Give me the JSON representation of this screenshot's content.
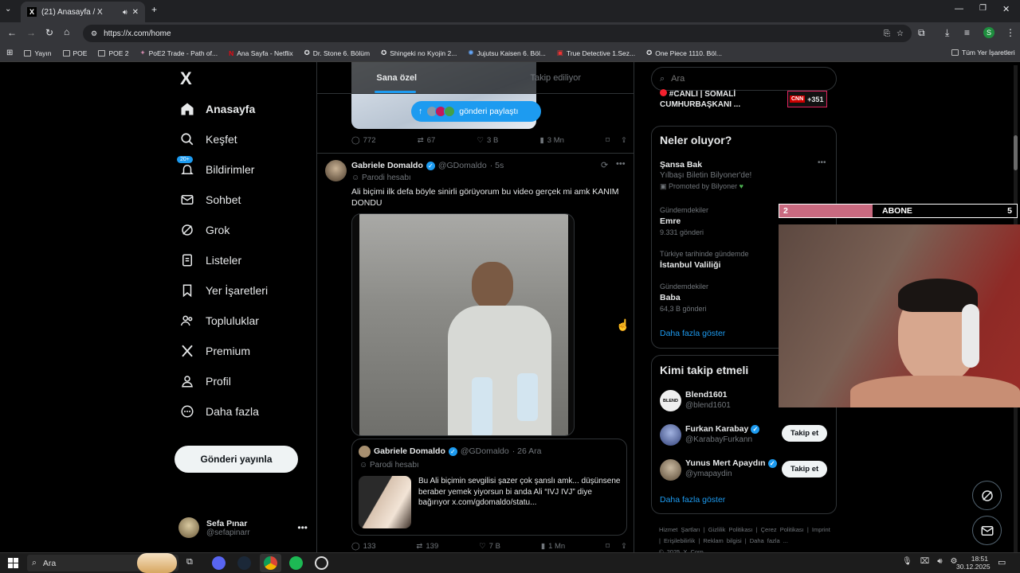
{
  "browser": {
    "tab_title": "(21) Anasayfa / X",
    "url": "https://x.com/home",
    "profile_initial": "S",
    "bookmarks": [
      "Yayın",
      "POE",
      "POE 2",
      "PoE2 Trade - Path of...",
      "Ana Sayfa - Netflix",
      "Dr. Stone 6. Bölüm",
      "Shingeki no Kyojin 2...",
      "Jujutsu Kaisen 6. Böl...",
      "True Detective 1.Sez...",
      "One Piece 1110. Böl..."
    ],
    "all_bookmarks": "Tüm Yer İşaretleri"
  },
  "sidebar": {
    "logo": "X",
    "notif_badge": "20+",
    "items": [
      "Anasayfa",
      "Keşfet",
      "Bildirimler",
      "Sohbet",
      "Grok",
      "Listeler",
      "Yer İşaretleri",
      "Topluluklar",
      "Premium",
      "Profil",
      "Daha fazla"
    ],
    "post_button": "Gönderi yayınla",
    "user_name": "Sefa Pınar",
    "user_handle": "@sefapinarr"
  },
  "feed": {
    "tabs": [
      "Sana özel",
      "Takip ediliyor"
    ],
    "share_pill": "gönderi paylaştı",
    "prev_stats": {
      "replies": "772",
      "reposts": "67",
      "likes": "3 B",
      "views": "3 Mn"
    },
    "post": {
      "author": "Gabriele Domaldo",
      "handle": "@GDomaldo",
      "time": "· 5s",
      "label": "Parodi hesabı",
      "text": "Ali biçimi ilk defa böyle sinirli görüyorum bu video gerçek mi amk KANIM DONDU",
      "quote": {
        "author": "Gabriele Domaldo",
        "handle": "@GDomaldo",
        "time": "· 26 Ara",
        "label": "Parodi hesabı",
        "text": "Bu Ali biçimin sevgilisi şazer çok şanslı amk... düşünsene beraber yemek yiyorsun bi anda Ali “IVJ IVJ” diye bağırıyor  x.com/gdomaldo/statu..."
      },
      "stats": {
        "replies": "133",
        "reposts": "139",
        "likes": "7 B",
        "views": "1 Mn"
      }
    }
  },
  "right": {
    "search_placeholder": "Ara",
    "live_banner": "#CANLI | SOMALİ CUMHURBAŞKANI ...",
    "live_count": "+351",
    "live_source": "CNN",
    "trends_title": "Neler oluyor?",
    "promo": {
      "title": "Şansa Bak",
      "sub": "Yılbaşı Biletin Bilyoner'de!",
      "promoted": "Promoted by Bilyoner"
    },
    "trends": [
      {
        "context": "Gündemdekiler",
        "name": "Emre",
        "count": "9.331 gönderi"
      },
      {
        "context": "Türkiye tarihinde gündemde",
        "name": "İstanbul Valiliği",
        "count": ""
      },
      {
        "context": "Gündemdekiler",
        "name": "Baba",
        "count": "64,3 B gönderi"
      }
    ],
    "show_more": "Daha fazla göster",
    "who_title": "Kimi takip etmeli",
    "who": [
      {
        "name": "Blend1601",
        "handle": "@blend1601",
        "avatar_text": "BLEND"
      },
      {
        "name": "Furkan Karabay",
        "handle": "@KarabayFurkann",
        "avatar_text": ""
      },
      {
        "name": "Yunus Mert Apaydın",
        "handle": "@ymapaydin",
        "avatar_text": ""
      }
    ],
    "follow_label": "Takip et",
    "who_more": "Daha fazla göster",
    "footer": [
      "Hizmet Şartları",
      "|",
      "Gizlilik Politikası",
      "|",
      "Çerez Politikası",
      "|",
      "Imprint",
      "|",
      "Erişilebilirlik",
      "|",
      "Reklam bilgisi",
      "|",
      "Daha fazla ..."
    ],
    "copyright": "© 2025 X Corp."
  },
  "overlay": {
    "left_num": "2",
    "label": "ABONE",
    "right_num": "5"
  },
  "taskbar": {
    "search": "Ara",
    "time": "18:51",
    "date": "30.12.2025"
  }
}
